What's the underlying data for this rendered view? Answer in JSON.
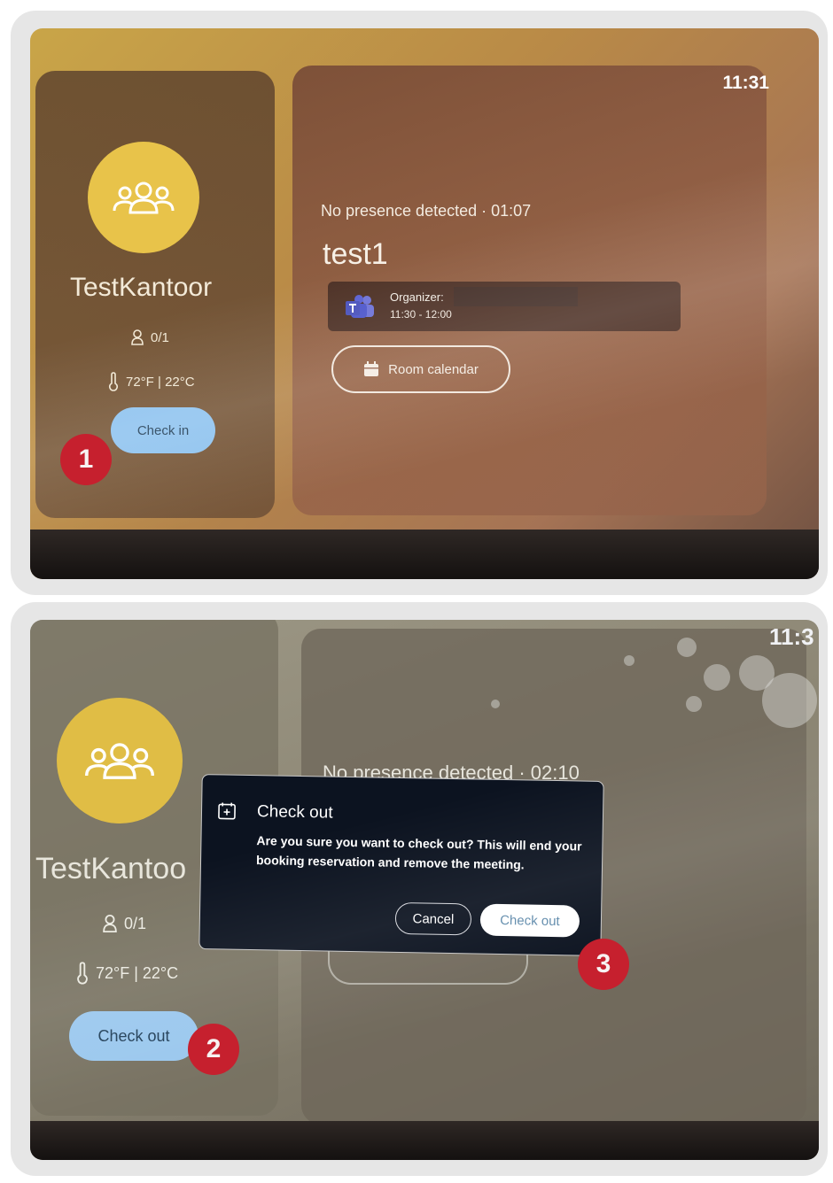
{
  "screen1": {
    "room_name": "TestKantoor",
    "occupancy": "0/1",
    "temperature": "72°F | 22°C",
    "check_in_label": "Check in",
    "clock": "11:31",
    "presence": "No presence detected · 01:07",
    "meeting_title": "test1",
    "organizer_label": "Organizer:",
    "meeting_time": "11:30 - 12:00",
    "room_calendar_label": "Room calendar",
    "step_badge": "1"
  },
  "screen2": {
    "room_name": "TestKantoo",
    "occupancy": "0/1",
    "temperature": "72°F | 22°C",
    "check_out_label": "Check out",
    "clock": "11:3",
    "presence": "No presence detected · 02:10",
    "dialog": {
      "title": "Check out",
      "body": "Are you sure you want to check out? This will end your booking reservation and remove the meeting.",
      "cancel_label": "Cancel",
      "confirm_label": "Check out"
    },
    "step_badge_2": "2",
    "step_badge_3": "3"
  },
  "colors": {
    "avatar": "#e8c34a",
    "check_button": "#8fc3ef",
    "badge": "#c6202e",
    "dialog_bg": "#0c1320"
  },
  "icons": [
    "group-icon",
    "person-icon",
    "thermometer-icon",
    "teams-icon",
    "calendar-icon",
    "calendar-plus-icon"
  ]
}
